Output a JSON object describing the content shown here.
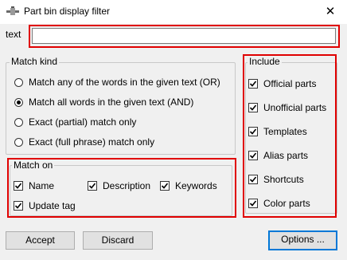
{
  "window": {
    "title": "Part bin display filter",
    "close_glyph": "✕"
  },
  "text_field": {
    "label": "text",
    "value": ""
  },
  "match_kind": {
    "legend": "Match kind",
    "options": [
      {
        "label": "Match any of the words in the given text  (OR)",
        "selected": false
      },
      {
        "label": "Match all words in the given text  (AND)",
        "selected": true
      },
      {
        "label": "Exact (partial) match only",
        "selected": false
      },
      {
        "label": "Exact (full phrase) match only",
        "selected": false
      }
    ]
  },
  "match_on": {
    "legend": "Match on",
    "name": "Name",
    "description": "Description",
    "keywords": "Keywords",
    "update_tag": "Update tag"
  },
  "include": {
    "legend": "Include",
    "items": [
      "Official parts",
      "Unofficial parts",
      "Templates",
      "Alias parts",
      "Shortcuts",
      "Color parts"
    ]
  },
  "buttons": {
    "accept": "Accept",
    "discard": "Discard",
    "options": "Options ..."
  }
}
